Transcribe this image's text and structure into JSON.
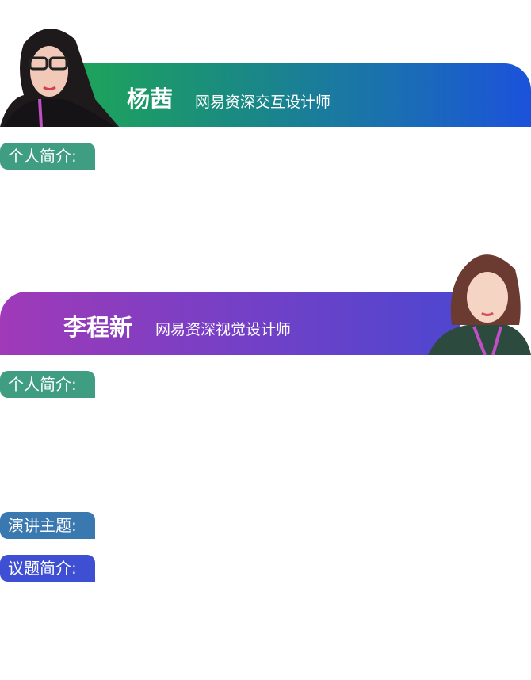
{
  "speakers": [
    {
      "name": "杨茜",
      "title": "网易资深交互设计师",
      "intro_label": "个人简介:",
      "gradient": [
        "#1ea35a",
        "#1b52db"
      ]
    },
    {
      "name": "李程新",
      "title": "网易资深视觉设计师",
      "intro_label": "个人简介:",
      "gradient": [
        "#a03ab8",
        "#4f46d0"
      ]
    }
  ],
  "talk": {
    "topic_label": "演讲主题:",
    "summary_label": "议题简介:"
  },
  "colors": {
    "intro_tag": "#3f9e82",
    "topic_tag": "#3a78b0",
    "summary_tag": "#3e4fd4"
  }
}
